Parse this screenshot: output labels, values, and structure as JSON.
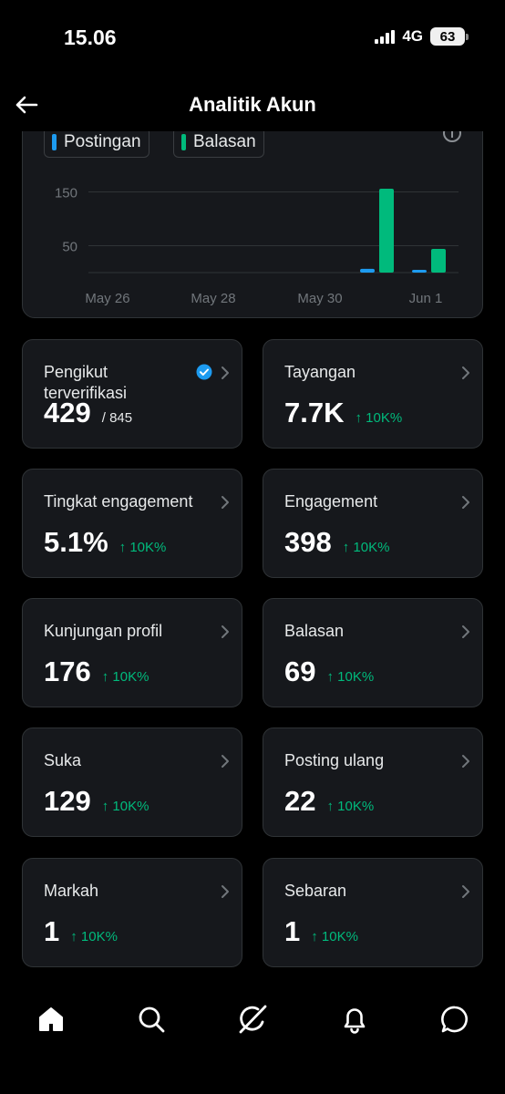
{
  "status_bar": {
    "time": "15.06",
    "network": "4G",
    "battery": "63"
  },
  "header": {
    "title": "Analitik Akun"
  },
  "chart": {
    "legend": [
      {
        "label": "Postingan",
        "color": "#1d9bf0"
      },
      {
        "label": "Balasan",
        "color": "#00ba7c"
      }
    ]
  },
  "chart_data": {
    "type": "bar",
    "title": "",
    "xlabel": "",
    "ylabel": "",
    "x_ticks": [
      "May 26",
      "May 28",
      "May 30",
      "Jun 1"
    ],
    "y_ticks": [
      "150",
      "50"
    ],
    "grid": true,
    "categories": [
      "May 26",
      "May 27",
      "May 28",
      "May 29",
      "May 30",
      "May 31",
      "Jun 1"
    ],
    "series": [
      {
        "name": "Postingan",
        "color": "#1d9bf0",
        "values": [
          0,
          0,
          0,
          0,
          0,
          7,
          2
        ]
      },
      {
        "name": "Balasan",
        "color": "#00ba7c",
        "values": [
          0,
          0,
          0,
          0,
          0,
          156,
          44
        ]
      }
    ]
  },
  "stats": [
    {
      "label": "Pengikut terverifikasi",
      "value": "429",
      "total": "/ 845",
      "verified": true
    },
    {
      "label": "Tayangan",
      "value": "7.7K",
      "change": "↑ 10K%"
    },
    {
      "label": "Tingkat engagement",
      "value": "5.1%",
      "change": "↑ 10K%"
    },
    {
      "label": "Engagement",
      "value": "398",
      "change": "↑ 10K%"
    },
    {
      "label": "Kunjungan profil",
      "value": "176",
      "change": "↑ 10K%"
    },
    {
      "label": "Balasan",
      "value": "69",
      "change": "↑ 10K%"
    },
    {
      "label": "Suka",
      "value": "129",
      "change": "↑ 10K%"
    },
    {
      "label": "Posting ulang",
      "value": "22",
      "change": "↑ 10K%"
    },
    {
      "label": "Markah",
      "value": "1",
      "change": "↑ 10K%"
    },
    {
      "label": "Sebaran",
      "value": "1",
      "change": "↑ 10K%"
    }
  ],
  "nav": {
    "items": [
      "home-icon",
      "search-icon",
      "grok-icon",
      "notifications-icon",
      "messages-icon"
    ]
  },
  "colors": {
    "accent": "#1d9bf0",
    "positive": "#00ba7c",
    "card": "#16181c",
    "border": "#2f3336"
  }
}
